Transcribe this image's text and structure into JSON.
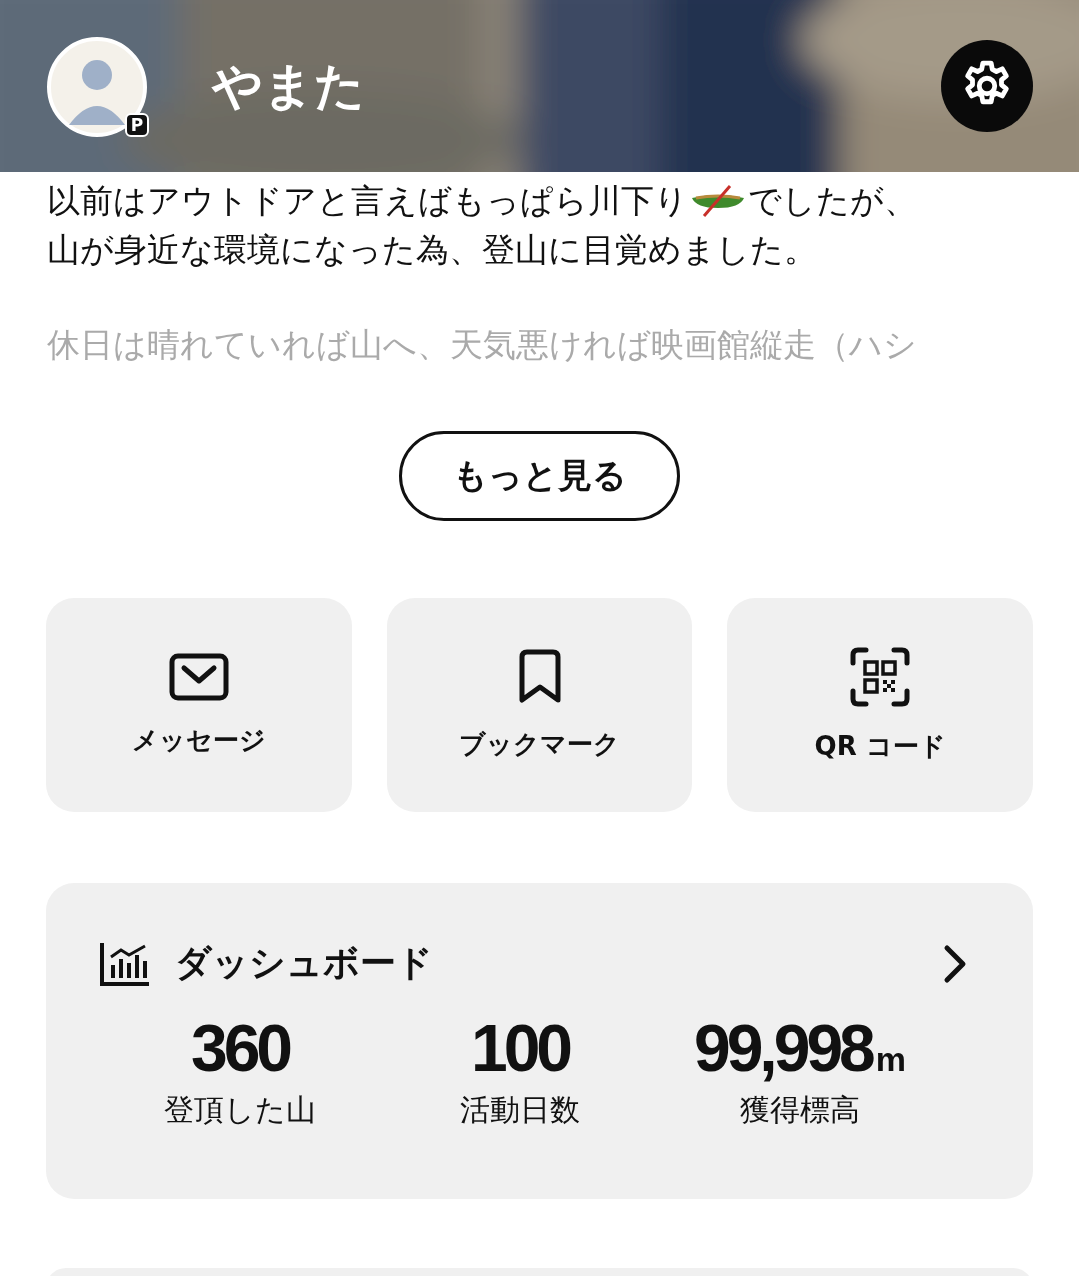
{
  "header": {
    "kind": "picture",
    "user_name": "やまた",
    "avatar_badge": "P"
  },
  "bio": {
    "line_1_before_icon": "以前はアウトドアと言えばもっぱら川下り",
    "line_1_after_icon": "でしたが、",
    "line_2": "山が身近な環境になった為、登山に目覚めました。",
    "faded_line": "休日は晴れていれば山へ、天気悪ければ映画館縦走（ハシ"
  },
  "more_button": "もっと見る",
  "actions": [
    {
      "kind": "message",
      "label": "メッセージ"
    },
    {
      "kind": "bookmark",
      "label": "ブックマーク"
    },
    {
      "kind": "qr",
      "label": "QR コード"
    }
  ],
  "dashboard": {
    "title": "ダッシュボード",
    "stats": [
      {
        "value": "360",
        "label": "登頂した山"
      },
      {
        "value": "100",
        "label": "活動日数"
      },
      {
        "value": "99,998",
        "unit": "m",
        "label": "獲得標高"
      }
    ]
  }
}
